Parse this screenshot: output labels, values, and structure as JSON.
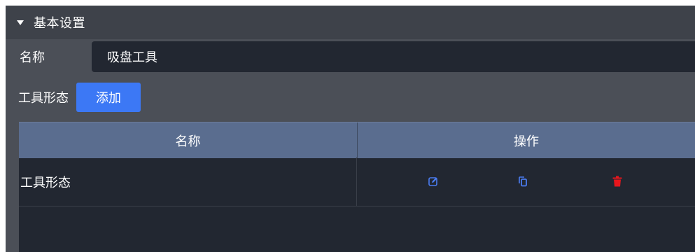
{
  "section": {
    "title": "基本设置"
  },
  "name_field": {
    "label": "名称",
    "value": "吸盘工具"
  },
  "forms": {
    "label": "工具形态",
    "add_label": "添加"
  },
  "table": {
    "headers": [
      "名称",
      "操作"
    ],
    "rows": [
      {
        "name": "工具形态"
      }
    ]
  },
  "icons": {
    "edit": "edit-icon",
    "copy": "copy-icon",
    "delete": "trash-icon"
  },
  "colors": {
    "accent": "#3c78f5",
    "edit_icon": "#4a7cf0",
    "copy_icon": "#4a7cf0",
    "delete_icon": "#e8161c",
    "header_bg": "#5a6d8f"
  }
}
